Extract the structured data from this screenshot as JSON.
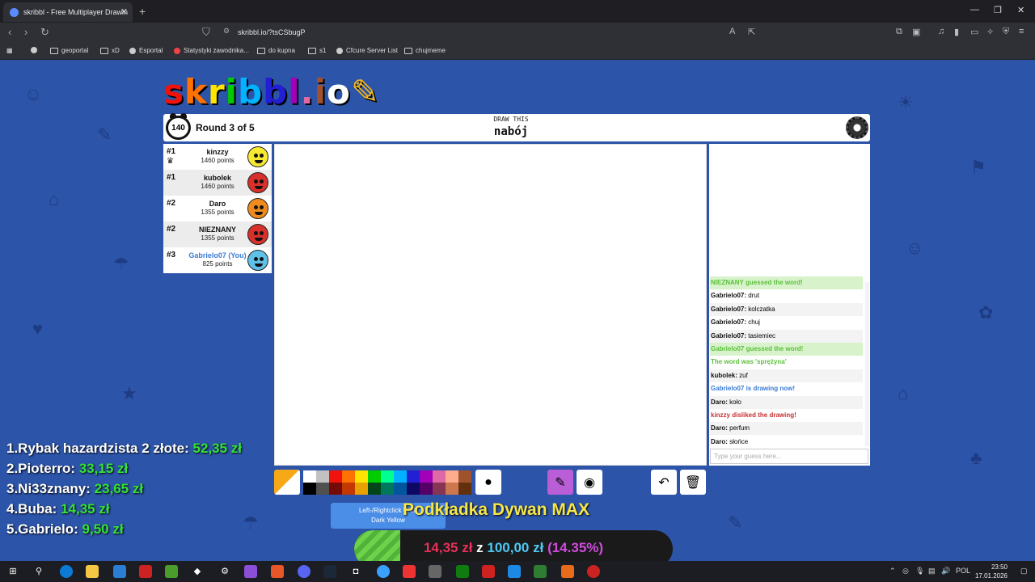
{
  "browser": {
    "tab_title": "skribbl - Free Multiplayer Drawin",
    "tab_close": "✕",
    "new_tab": "+",
    "url": "skribbl.io/?tsCSbugP",
    "bookmarks": [
      "geoportal",
      "xD",
      "Esportal",
      "Statystyki zawodnika...",
      "do kupna",
      "s1",
      "Cfcure Server List",
      "chujmeme"
    ]
  },
  "game": {
    "logo": "skribbl.io",
    "timer": "140",
    "round": "Round 3 of 5",
    "draw_this": "DRAW THIS",
    "word": "nabój",
    "players": [
      {
        "rank": "#1",
        "name": "kinzzy",
        "points": "1460 points",
        "color": "#f6e930"
      },
      {
        "rank": "#1",
        "name": "kubolek",
        "points": "1460 points",
        "color": "#d8302a"
      },
      {
        "rank": "#2",
        "name": "Daro",
        "points": "1355 points",
        "color": "#ef8a1c"
      },
      {
        "rank": "#2",
        "name": "NIEZNANY",
        "points": "1355 points",
        "color": "#d8302a"
      },
      {
        "rank": "#3",
        "name": "Gabrielo07 (You)",
        "points": "825 points",
        "color": "#5fc0e8"
      }
    ],
    "chat": [
      {
        "text": "NIEZNANY guessed the word!",
        "style": "guess"
      },
      {
        "author": "Gabrielo07:",
        "msg": "drut",
        "style": "even"
      },
      {
        "author": "Gabrielo07:",
        "msg": "kolczatka",
        "style": "odd"
      },
      {
        "author": "Gabrielo07:",
        "msg": "chuj",
        "style": "even"
      },
      {
        "author": "Gabrielo07:",
        "msg": "tasiemiec",
        "style": "odd"
      },
      {
        "text": "Gabrielo07 guessed the word!",
        "style": "guess"
      },
      {
        "text": "The word was 'sprężyna'",
        "style": "guess2"
      },
      {
        "author": "kubolek:",
        "msg": "zuf",
        "style": "odd"
      },
      {
        "text": "Gabrielo07 is drawing now!",
        "style": "draw"
      },
      {
        "author": "Daro:",
        "msg": "koło",
        "style": "odd"
      },
      {
        "text": "kinzzy disliked the drawing!",
        "style": "dislike"
      },
      {
        "author": "Daro:",
        "msg": "perfum",
        "style": "odd"
      },
      {
        "author": "Daro:",
        "msg": "słońce",
        "style": "even"
      }
    ],
    "guess_placeholder": "Type your guess here...",
    "palette_top": [
      "#ffffff",
      "#c1c1c1",
      "#ef130b",
      "#ff7100",
      "#ffe400",
      "#00cc00",
      "#00ff91",
      "#00b2ff",
      "#231fd3",
      "#a300ba",
      "#df69a7",
      "#ffac8e",
      "#a0522d"
    ],
    "palette_bottom": [
      "#000000",
      "#505050",
      "#740b07",
      "#c23800",
      "#e8a200",
      "#004619",
      "#00785d",
      "#00569e",
      "#0e0865",
      "#550069",
      "#873554",
      "#cc774d",
      "#63300d"
    ],
    "tooltip_line1": "Left-/Rightclick to ch",
    "tooltip_line2": "Dark Yellow",
    "tool_keys": {
      "pen": "B",
      "fill": "F",
      "undo": "U",
      "clear": "C"
    }
  },
  "overlay": {
    "leaderboard": [
      {
        "label": "1.Rybak hazardzista 2 złote: ",
        "amount": "52,35 zł"
      },
      {
        "label": "2.Pioterro: ",
        "amount": "33,15 zł"
      },
      {
        "label": "3.Ni33znany: ",
        "amount": "23,65 zł"
      },
      {
        "label": "4.Buba: ",
        "amount": "14,35 zł"
      },
      {
        "label": "5.Gabrielo: ",
        "amount": "9,50 zł"
      }
    ],
    "product": "Podkładka Dywan MAX",
    "donation": {
      "current": "14,35 zł",
      "z": " z ",
      "goal": "100,00 zł",
      "pct": " (14.35%)",
      "progress": 0.1435
    }
  },
  "taskbar": {
    "lang": "POL",
    "time": "23:50",
    "date": "17.01.2026"
  }
}
